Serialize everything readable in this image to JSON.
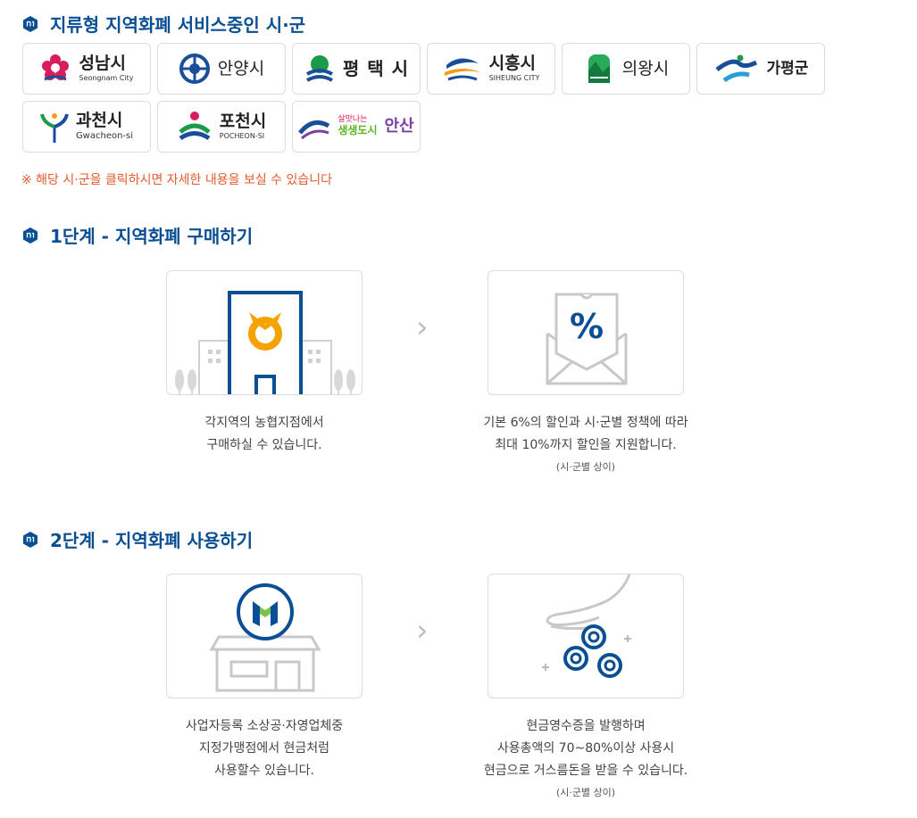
{
  "section1": {
    "title": "지류형 지역화폐 서비스중인 시·군"
  },
  "cities": [
    {
      "name": "성남시",
      "sub": "Seongnam City"
    },
    {
      "name": "안양시",
      "sub": ""
    },
    {
      "name": "평 택 시",
      "sub": ""
    },
    {
      "name": "시흥시",
      "sub": "SIHEUNG CITY"
    },
    {
      "name": "의왕시",
      "sub": ""
    },
    {
      "name": "가평군",
      "sub": ""
    },
    {
      "name": "과천시",
      "sub": "Gwacheon-si"
    },
    {
      "name": "포천시",
      "sub": "POCHEON-SI"
    },
    {
      "name": "안산",
      "sub": "",
      "slogan": [
        "살맛나는",
        "생생도시"
      ]
    }
  ],
  "note": "※ 해당 시·군을 클릭하시면 자세한 내용을 보실 수 있습니다",
  "step1": {
    "title": "1단계 - 지역화폐 구매하기",
    "left": [
      "각지역의 농협지점에서",
      "구매하실 수 있습니다."
    ],
    "right": [
      "기본 6%의 할인과 시·군별 정책에 따라",
      "최대 10%까지 할인을 지원합니다."
    ],
    "right_note": "(시·군별 상이)",
    "coupon_symbol": "%"
  },
  "step2": {
    "title": "2단계 - 지역화폐 사용하기",
    "left": [
      "사업자등록 소상공·자영업체중",
      "지정가맹점에서 현금처럼",
      "사용할수 있습니다."
    ],
    "right": [
      "현금영수증을 발행하며",
      "사용총액의 70~80%이상 사용시",
      "현금으로 거스름돈을 받을 수 있습니다."
    ],
    "right_note": "(시·군별 상이)"
  },
  "arrow_glyph": "›",
  "colors": {
    "brand_blue": "#0a4f93",
    "note_orange": "#e05a2b",
    "nh_yellow": "#f5a300"
  }
}
